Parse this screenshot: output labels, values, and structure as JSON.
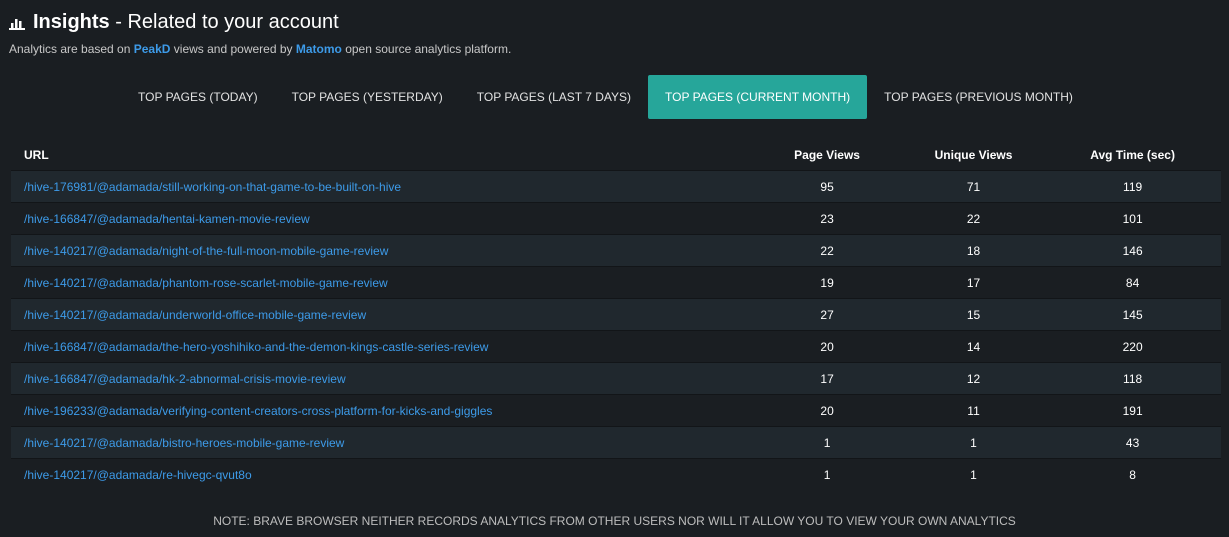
{
  "header": {
    "icon": "bar-chart-icon",
    "title_bold": "Insights",
    "title_rest": " - Related to your account",
    "subtitle_pre": "Analytics are based on ",
    "subtitle_link1": "PeakD",
    "subtitle_mid": " views and powered by ",
    "subtitle_link2": "Matomo",
    "subtitle_post": " open source analytics platform."
  },
  "tabs": [
    {
      "label": "TOP PAGES (TODAY)",
      "active": false
    },
    {
      "label": "TOP PAGES (YESTERDAY)",
      "active": false
    },
    {
      "label": "TOP PAGES (LAST 7 DAYS)",
      "active": false
    },
    {
      "label": "TOP PAGES (CURRENT MONTH)",
      "active": true
    },
    {
      "label": "TOP PAGES (PREVIOUS MONTH)",
      "active": false
    }
  ],
  "table": {
    "headers": {
      "url": "URL",
      "page_views": "Page Views",
      "unique_views": "Unique Views",
      "avg_time": "Avg Time (sec)"
    },
    "rows": [
      {
        "url": "/hive-176981/@adamada/still-working-on-that-game-to-be-built-on-hive",
        "page_views": "95",
        "unique_views": "71",
        "avg_time": "119"
      },
      {
        "url": "/hive-166847/@adamada/hentai-kamen-movie-review",
        "page_views": "23",
        "unique_views": "22",
        "avg_time": "101"
      },
      {
        "url": "/hive-140217/@adamada/night-of-the-full-moon-mobile-game-review",
        "page_views": "22",
        "unique_views": "18",
        "avg_time": "146"
      },
      {
        "url": "/hive-140217/@adamada/phantom-rose-scarlet-mobile-game-review",
        "page_views": "19",
        "unique_views": "17",
        "avg_time": "84"
      },
      {
        "url": "/hive-140217/@adamada/underworld-office-mobile-game-review",
        "page_views": "27",
        "unique_views": "15",
        "avg_time": "145"
      },
      {
        "url": "/hive-166847/@adamada/the-hero-yoshihiko-and-the-demon-kings-castle-series-review",
        "page_views": "20",
        "unique_views": "14",
        "avg_time": "220"
      },
      {
        "url": "/hive-166847/@adamada/hk-2-abnormal-crisis-movie-review",
        "page_views": "17",
        "unique_views": "12",
        "avg_time": "118"
      },
      {
        "url": "/hive-196233/@adamada/verifying-content-creators-cross-platform-for-kicks-and-giggles",
        "page_views": "20",
        "unique_views": "11",
        "avg_time": "191"
      },
      {
        "url": "/hive-140217/@adamada/bistro-heroes-mobile-game-review",
        "page_views": "1",
        "unique_views": "1",
        "avg_time": "43"
      },
      {
        "url": "/hive-140217/@adamada/re-hivegc-qvut8o",
        "page_views": "1",
        "unique_views": "1",
        "avg_time": "8"
      }
    ]
  },
  "note": "NOTE: BRAVE BROWSER NEITHER RECORDS ANALYTICS FROM OTHER USERS NOR WILL IT ALLOW YOU TO VIEW YOUR OWN ANALYTICS",
  "colors": {
    "accent": "#26a69a",
    "link": "#3d9be9",
    "background": "#1a1e22",
    "row_stripe": "#20282e"
  }
}
